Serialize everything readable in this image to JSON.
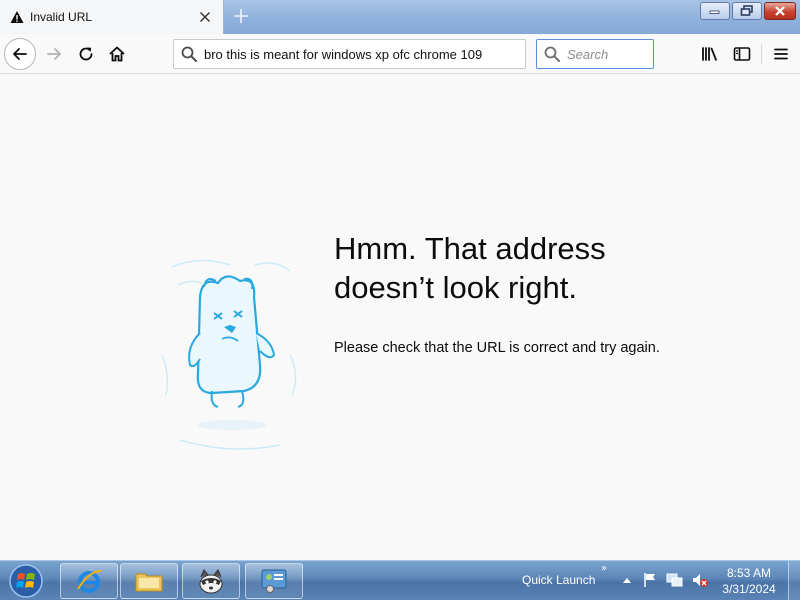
{
  "tab": {
    "title": "Invalid URL",
    "icon": "warning-icon"
  },
  "nav": {
    "url_value": "bro this is meant for windows xp ofc chrome 109",
    "search_placeholder": "Search"
  },
  "page": {
    "heading_line1": "Hmm. That address",
    "heading_line2": "doesn’t look right.",
    "description": "Please check that the URL is correct and try again."
  },
  "taskbar": {
    "quick_launch": "Quick Launch",
    "quick_launch_chevron": "»",
    "time": "8:53 AM",
    "date": "3/31/2024"
  },
  "colors": {
    "tabstrip": "#8fb0dc",
    "search_focus_border": "#5b8fd6",
    "illustration_blue": "#2aa8e0",
    "close_button_red": "#c7422f"
  }
}
